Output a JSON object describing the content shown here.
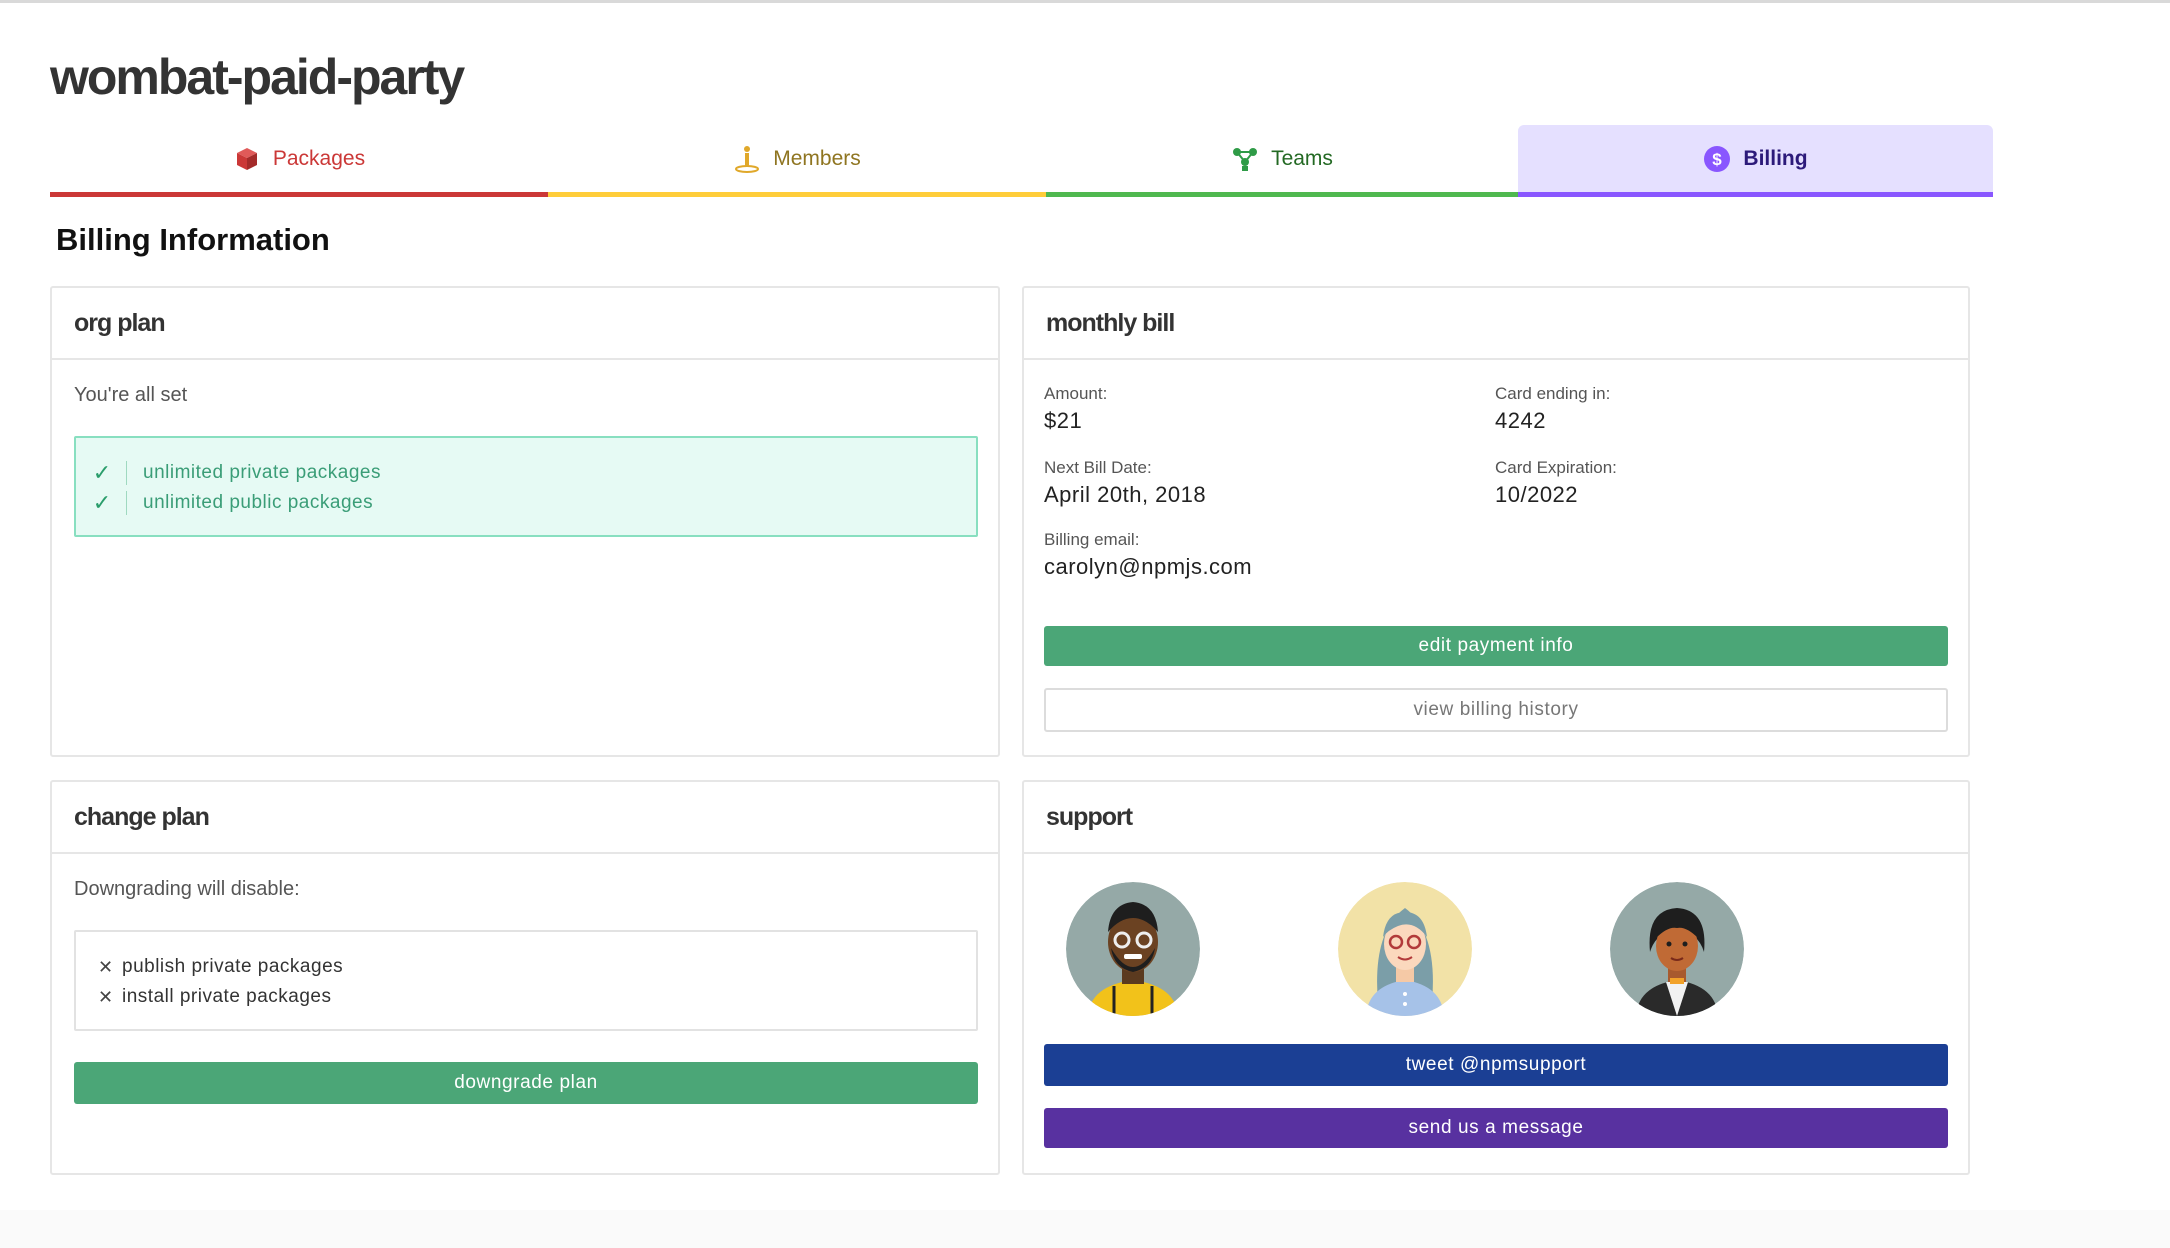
{
  "org": {
    "name": "wombat-paid-party"
  },
  "tabs": [
    {
      "label": "Packages",
      "icon": "package-icon",
      "color": "#cb3837"
    },
    {
      "label": "Members",
      "icon": "member-icon",
      "color": "#ffcd3a"
    },
    {
      "label": "Teams",
      "icon": "teams-icon",
      "color": "#4fb84f"
    },
    {
      "label": "Billing",
      "icon": "dollar-icon",
      "color": "#8956ff",
      "active": true
    }
  ],
  "section_title": "Billing Information",
  "org_plan": {
    "title": "org plan",
    "status": "You're all set",
    "benefits": [
      "unlimited private packages",
      "unlimited public packages"
    ]
  },
  "monthly_bill": {
    "title": "monthly bill",
    "amount_label": "Amount:",
    "amount": "$21",
    "card_label": "Card ending in:",
    "card": "4242",
    "next_date_label": "Next Bill Date:",
    "next_date": "April 20th, 2018",
    "expiration_label": "Card Expiration:",
    "expiration": "10/2022",
    "email_label": "Billing email:",
    "email": "carolyn@npmjs.com",
    "edit_button": "edit payment info",
    "history_button": "view billing history"
  },
  "change_plan": {
    "title": "change plan",
    "intro": "Downgrading will disable:",
    "items": [
      "publish private packages",
      "install private packages"
    ],
    "downgrade_button": "downgrade plan"
  },
  "support": {
    "title": "support",
    "tweet_button": "tweet @npmsupport",
    "message_button": "send us a message"
  },
  "colors": {
    "green": "#4ba677",
    "blue": "#1b3f94",
    "purple": "#5831a0"
  }
}
